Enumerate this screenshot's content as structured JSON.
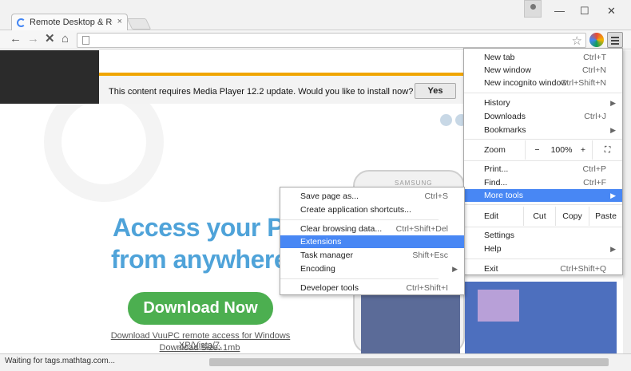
{
  "browser": {
    "tab_title": "Remote Desktop & Remot",
    "tab_close": "×",
    "win_minimize": "—",
    "win_maximize": "☐",
    "win_close": "✕",
    "back": "←",
    "forward": "→",
    "stop": "✕",
    "home": "⌂",
    "star": "☆",
    "status": "Waiting for tags.mathtag.com..."
  },
  "ad_bar": {
    "message": "This content requires Media Player 12.2 update. Would you like to install now?",
    "yes_label": "Yes"
  },
  "page": {
    "hero_line1": "Access your PC",
    "hero_line2": "from anywhere",
    "download_button": "Download Now",
    "download_link": "Download VuuPC remote access for Windows XP/Vista/7.",
    "download_size": "Download Size: 1mb",
    "phone_brand": "SAMSUNG"
  },
  "main_menu": {
    "new_tab": "New tab",
    "new_tab_sc": "Ctrl+T",
    "new_window": "New window",
    "new_window_sc": "Ctrl+N",
    "new_incognito": "New incognito window",
    "new_incognito_sc": "Ctrl+Shift+N",
    "history": "History",
    "downloads": "Downloads",
    "downloads_sc": "Ctrl+J",
    "bookmarks": "Bookmarks",
    "zoom": "Zoom",
    "zoom_minus": "−",
    "zoom_value": "100%",
    "zoom_plus": "+",
    "print": "Print...",
    "print_sc": "Ctrl+P",
    "find": "Find...",
    "find_sc": "Ctrl+F",
    "more_tools": "More tools",
    "edit": "Edit",
    "cut": "Cut",
    "copy": "Copy",
    "paste": "Paste",
    "settings": "Settings",
    "help": "Help",
    "exit": "Exit",
    "exit_sc": "Ctrl+Shift+Q",
    "submenu_arrow": "▶"
  },
  "more_tools_menu": {
    "save_page": "Save page as...",
    "save_page_sc": "Ctrl+S",
    "create_shortcuts": "Create application shortcuts...",
    "clear_browsing": "Clear browsing data...",
    "clear_browsing_sc": "Ctrl+Shift+Del",
    "extensions": "Extensions",
    "task_manager": "Task manager",
    "task_manager_sc": "Shift+Esc",
    "encoding": "Encoding",
    "developer_tools": "Developer tools",
    "developer_tools_sc": "Ctrl+Shift+I"
  }
}
